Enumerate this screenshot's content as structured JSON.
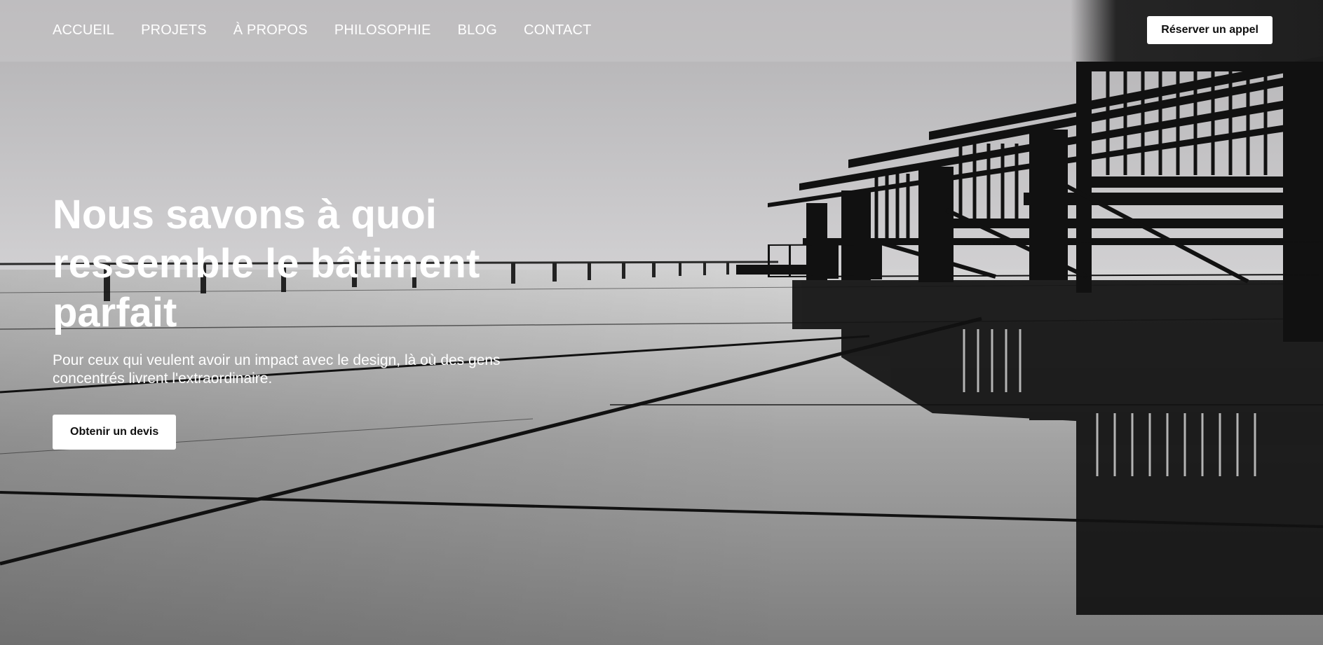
{
  "nav": {
    "items": [
      {
        "label": "ACCUEIL"
      },
      {
        "label": "PROJETS"
      },
      {
        "label": "À PROPOS"
      },
      {
        "label": "PHILOSOPHIE"
      },
      {
        "label": "BLOG"
      },
      {
        "label": "CONTACT"
      }
    ],
    "cta_label": "Réserver un appel"
  },
  "hero": {
    "title": "Nous savons à quoi ressemble le bâtiment parfait",
    "subtitle": "Pour ceux qui veulent avoir un impact avec le design, là où des gens concentrés livrent l'extraordinaire.",
    "cta_label": "Obtenir un devis"
  },
  "colors": {
    "sky": "#c6c5c7",
    "ground": "#8a8a8a",
    "structure": "#111111",
    "button_bg": "#ffffff",
    "button_text": "#0f0f0f"
  }
}
